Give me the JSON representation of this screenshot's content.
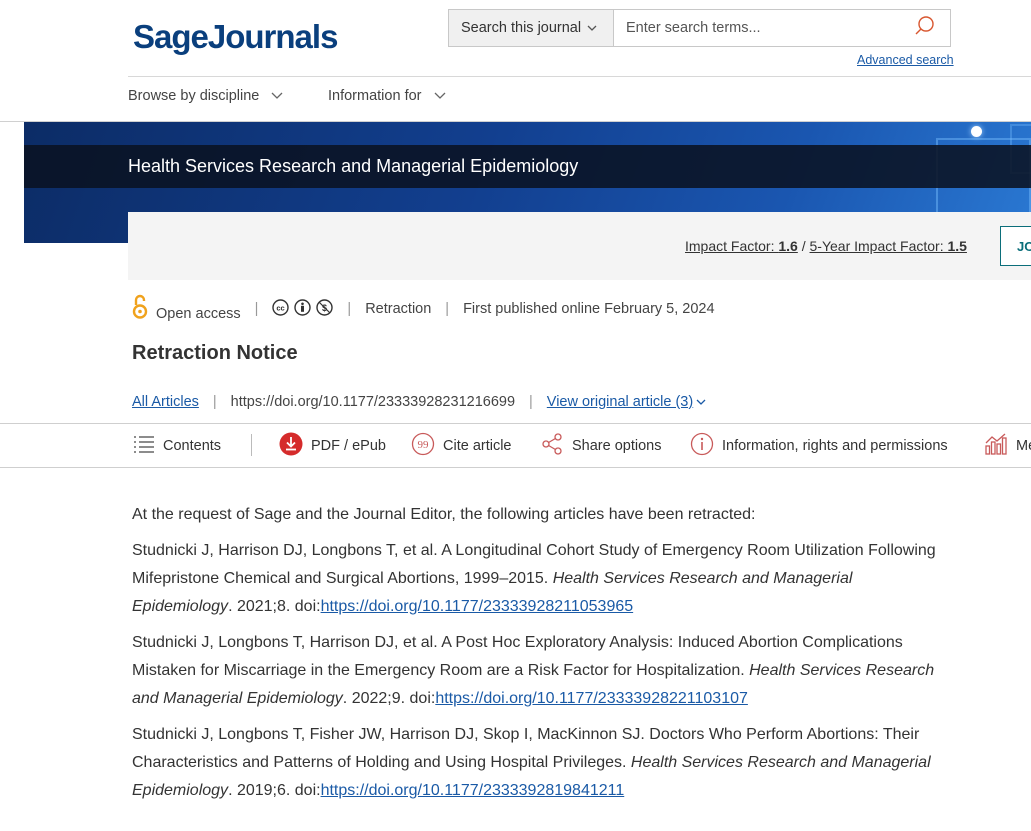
{
  "header": {
    "logo": {
      "sage": "Sage",
      "journals": "Journals"
    },
    "search": {
      "scope_label": "Search this journal",
      "placeholder": "Enter search terms...",
      "advanced_link": "Advanced search"
    },
    "nav": [
      {
        "label": "Browse by discipline"
      },
      {
        "label": "Information for"
      }
    ]
  },
  "banner": {
    "journal_title": "Health Services Research and Managerial Epidemiology"
  },
  "impact": {
    "if_label": "Impact Factor: ",
    "if_value": "1.6",
    "sep": " / ",
    "five_label": "5-Year Impact Factor: ",
    "five_value": "1.5",
    "journal_btn": "JO"
  },
  "meta": {
    "open_access": "Open access",
    "article_type": "Retraction",
    "published": "First published online February 5, 2024"
  },
  "article": {
    "title": "Retraction Notice",
    "all_articles": "All Articles",
    "doi": "https://doi.org/10.1177/23333928231216699",
    "view_original": "View original article (3)"
  },
  "toolbar": {
    "contents": "Contents",
    "pdf": "PDF / ePub",
    "cite": "Cite article",
    "share": "Share options",
    "info": "Information, rights and permissions",
    "metrics": "Me"
  },
  "body": {
    "intro": "At the request of Sage and the Journal Editor, the following articles have been retracted:",
    "refs": [
      {
        "authors_title": "Studnicki J, Harrison DJ, Longbons T, et al. A Longitudinal Cohort Study of Emergency Room Utilization Following Mifepristone Chemical and Surgical Abortions, 1999–2015. ",
        "journal": "Health Services Research and Managerial Epidemiology",
        "tail": ". 2021;8. doi:",
        "doi": "https://doi.org/10.1177/23333928211053965"
      },
      {
        "authors_title": "Studnicki J, Longbons T, Harrison DJ, et al. A Post Hoc Exploratory Analysis: Induced Abortion Complications Mistaken for Miscarriage in the Emergency Room are a Risk Factor for Hospitalization. ",
        "journal": "Health Services Research and Managerial Epidemiology",
        "tail": ". 2022;9. doi:",
        "doi": "https://doi.org/10.1177/23333928221103107"
      },
      {
        "authors_title": "Studnicki J, Longbons T, Fisher JW, Harrison DJ, Skop I, MacKinnon SJ. Doctors Who Perform Abortions: Their Characteristics and Patterns of Holding and Using Hospital Privileges. ",
        "journal": "Health Services Research and Managerial Epidemiology",
        "tail": ". 2019;6. doi:",
        "doi": "https://doi.org/10.1177/233339281984121​1"
      }
    ]
  },
  "colors": {
    "brand": "#0a3f7d",
    "link": "#1a5aa6",
    "oa_orange": "#f0a21c",
    "pdf_red": "#d52b2b",
    "cite_accent": "#c85a5a"
  }
}
